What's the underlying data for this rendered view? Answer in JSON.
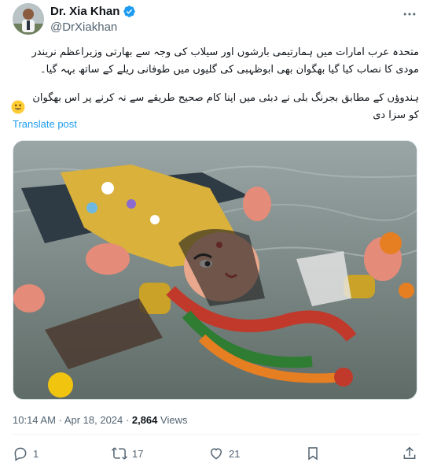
{
  "author": {
    "display_name": "Dr. Xia Khan",
    "handle": "@DrXiakhan",
    "avatar_icon": "profile-photo",
    "verified_icon": "verified-badge-icon",
    "verified_color": "#1d9bf0"
  },
  "post": {
    "paragraph_1": "متحدہ عرب امارات میں ہمارتیمی بارشوں اور سیلاب کی وجہ سے بھارتی وزیراعظم نریندر مودی کا نصاب کیا گیا بھگوان بھی ابوظہبی کی گلیوں میں طوفانی ریلے کے ساتھ بہہ گیا۔",
    "paragraph_2": "ہندوؤں کے مطابق بجرنگ بلی نے دبئی میں اپنا کام صحیح طریقے سے نہ کرنے پر اس بھگوان کو سزا دی",
    "emoji_icon": "grinning-face-emoji",
    "translate_label": "Translate post"
  },
  "media": {
    "alt_icon": "photo-idol-in-flood-water"
  },
  "meta": {
    "time": "10:14 AM",
    "separator": "·",
    "date": "Apr 18, 2024",
    "views_count": "2,864",
    "views_label": "Views"
  },
  "actions": {
    "reply_count": "1",
    "repost_count": "17",
    "like_count": "21",
    "bookmark_icon": "bookmark-icon",
    "share_icon": "share-icon"
  },
  "colors": {
    "text_primary": "#0f1419",
    "text_secondary": "#536471",
    "link": "#1d9bf0"
  }
}
